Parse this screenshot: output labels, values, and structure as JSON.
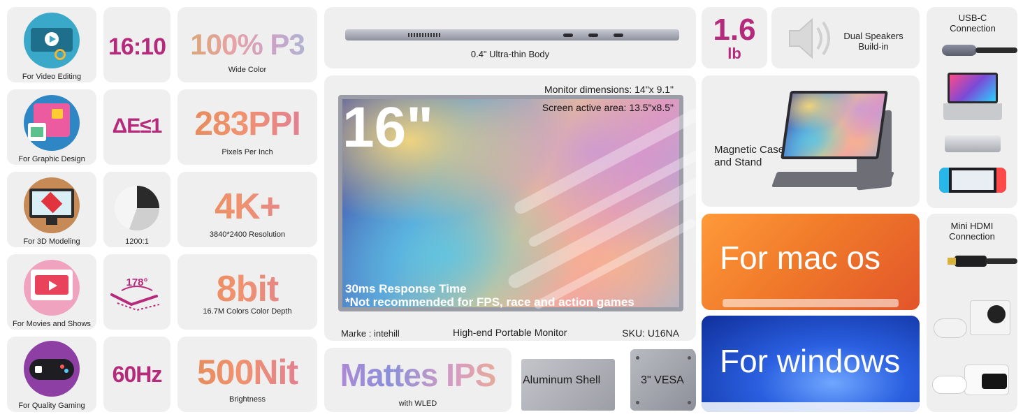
{
  "col1": [
    {
      "label": "For Video Editing",
      "icon": "film-scissors-icon",
      "color": "#3aa9c9"
    },
    {
      "label": "For Graphic Design",
      "icon": "design-canvas-icon",
      "color": "#2f86c4"
    },
    {
      "label": "For 3D Modeling",
      "icon": "cube-monitor-icon",
      "color": "#c68a56"
    },
    {
      "label": "For Movies and Shows",
      "icon": "video-player-icon",
      "color": "#f0a3bf"
    },
    {
      "label": "For Quality Gaming",
      "icon": "gamepad-icon",
      "color": "#8e3fa3"
    }
  ],
  "col2": {
    "ratio": "16:10",
    "delta": "ΔE≤1",
    "contrast": "1200:1",
    "angle": "178°",
    "refresh": "60Hz"
  },
  "col3": [
    {
      "value": "100% P3",
      "caption": "Wide Color"
    },
    {
      "value": "283PPI",
      "caption": "Pixels Per Inch"
    },
    {
      "value": "4K+",
      "caption": "3840*2400 Resolution"
    },
    {
      "value": "8bit",
      "caption": "16.7M Colors Color Depth"
    },
    {
      "value": "500Nit",
      "caption": "Brightness"
    }
  ],
  "body": {
    "caption": "0.4\" Ultra-thin Body",
    "ports": [
      "HD",
      "⎓",
      "⎓"
    ]
  },
  "monitor": {
    "dimensions": "Monitor dimensions: 14\"x 9.1\"",
    "active_area": "Screen active area: 13.5\"x8.5\"",
    "size": "16\"",
    "response_time": "30ms Response Time",
    "note": "*Not recommended for FPS, race and action games",
    "brand": "Marke : intehill",
    "product": "High-end Portable Monitor",
    "sku": "SKU: U16NA"
  },
  "panel": {
    "value": "Mattes IPS",
    "caption": "with WLED"
  },
  "shell": "Aluminum Shell",
  "vesa": "3\" VESA",
  "weight": {
    "value": "1.6",
    "unit": "lb"
  },
  "speakers": "Dual Speakers Build-in",
  "stand": "Magnetic Case and Stand",
  "macos": "For mac os",
  "windows": "For windows",
  "connections": [
    {
      "label": "USB-C Connection"
    },
    {
      "label": "Mini HDMI Connection"
    }
  ],
  "colors": {
    "accent": "#b62a7b",
    "tile": "#efefef",
    "mac_orange": "#f07a2a",
    "win_blue": "#1f4fd6"
  }
}
